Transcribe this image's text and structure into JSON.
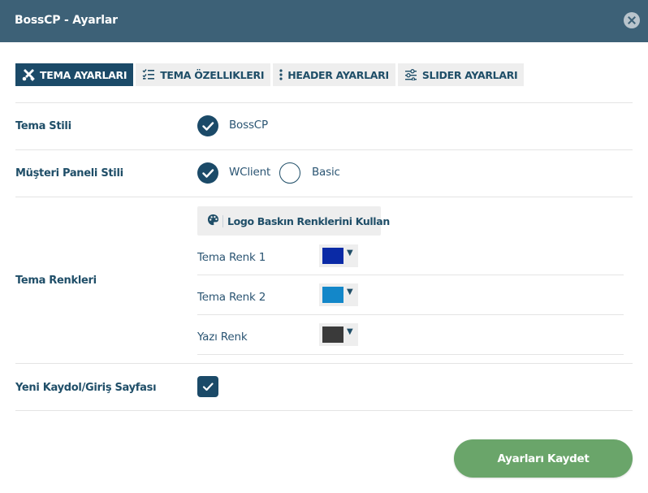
{
  "window": {
    "title": "BossCP - Ayarlar",
    "close_icon": "close-icon"
  },
  "tabs": [
    {
      "label": "TEMA AYARLARI",
      "icon": "tools-icon",
      "active": true
    },
    {
      "label": "TEMA ÖZELLIKLERI",
      "icon": "checklist-icon",
      "active": false
    },
    {
      "label": "HEADER AYARLARI",
      "icon": "vertical-dots-icon",
      "active": false
    },
    {
      "label": "SLIDER AYARLARI",
      "icon": "sliders-icon",
      "active": false
    }
  ],
  "tema_stili": {
    "label": "Tema Stili",
    "options": [
      {
        "label": "BossCP",
        "selected": true
      }
    ]
  },
  "musteri_paneli": {
    "label": "Müşteri Paneli Stili",
    "options": [
      {
        "label": "WClient",
        "selected": true
      },
      {
        "label": "Basic",
        "selected": false
      }
    ]
  },
  "tema_renkleri": {
    "label": "Tema Renkleri",
    "logo_button": "Logo Baskın Renklerini Kullan",
    "logo_icon": "palette-icon",
    "colors": [
      {
        "label": "Tema Renk 1",
        "value": "#0a2aa6"
      },
      {
        "label": "Tema Renk 2",
        "value": "#1387c9"
      },
      {
        "label": "Yazı Renk",
        "value": "#3a3a3a"
      }
    ]
  },
  "yeni_kaydol": {
    "label": "Yeni Kaydol/Giriş Sayfası",
    "checked": true
  },
  "save_button": "Ayarları Kaydet",
  "colors": {
    "header_bg": "#3d6177",
    "primary": "#1b4a68",
    "save_green": "#6aa56a",
    "tab_bg": "#eeeeee"
  }
}
